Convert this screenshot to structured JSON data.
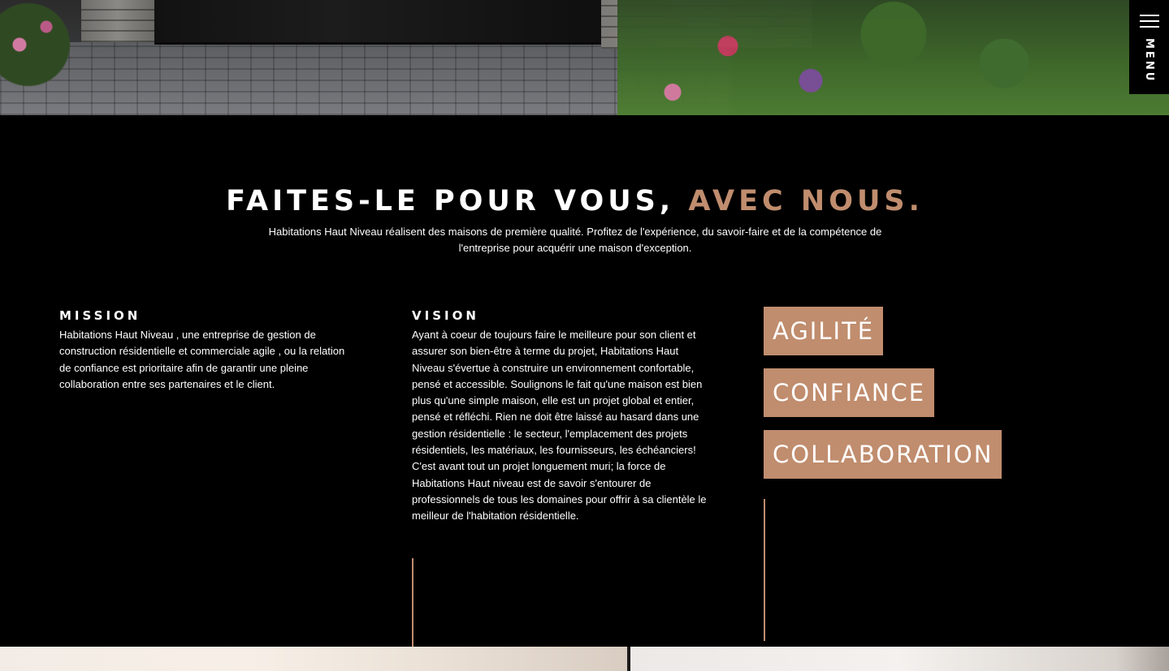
{
  "menu": {
    "label": "MENU"
  },
  "headline": {
    "main": "FAITES-LE POUR VOUS, ",
    "accent": "AVEC NOUS."
  },
  "intro": "Habitations Haut Niveau réalisent des maisons de première qualité. Profitez de l'expérience, du savoir-faire et de la compétence de l'entreprise pour acquérir une maison d'exception.",
  "mission": {
    "title": "MISSION",
    "text": "Habitations Haut Niveau , une entreprise de gestion de construction résidentielle et commerciale agile , ou la relation de confiance est prioritaire afin de garantir une pleine collaboration entre ses partenaires et le client."
  },
  "vision": {
    "title": "VISION",
    "text": "Ayant à coeur de toujours faire le meilleure pour son client et assurer son bien-être à terme du projet, Habitations Haut Niveau s'évertue à construire un environnement confortable, pensé et accessible. Soulignons le fait qu'une maison est bien plus qu'une simple maison, elle est un projet global et entier, pensé et réfléchi. Rien ne doit être laissé au hasard dans une gestion résidentielle : le secteur, l'emplacement des projets résidentiels, les matériaux, les fournisseurs, les échéanciers! C'est avant tout un projet longuement muri; la force de Habitations Haut niveau est de savoir s'entourer de professionnels de tous les domaines pour offrir à sa clientèle le meilleur de l'habitation résidentielle."
  },
  "values": [
    "AGILITÉ",
    "CONFIANCE",
    "COLLABORATION"
  ],
  "colors": {
    "accent": "#c08d6e",
    "background": "#000000",
    "text": "#ffffff"
  },
  "icons": {
    "menu": "hamburger-icon"
  }
}
